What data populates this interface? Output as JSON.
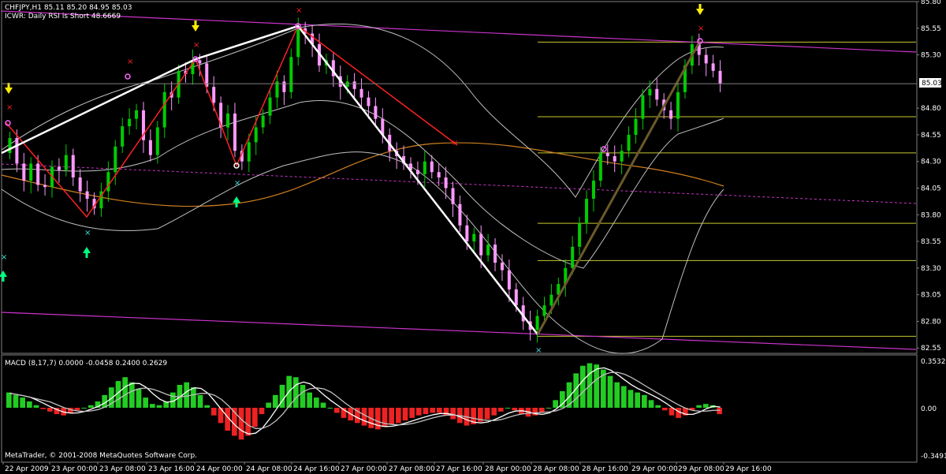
{
  "header": {
    "symbol_line": "CHFJPY,H1  85.11 85.20 84.95 85.03",
    "indicator_line": "ICWR: Daily RSI is Short 48.6669"
  },
  "macd_panel": {
    "label": "MACD  (8,17,7) 0.0000 -0.0458 0.2400 0.2629",
    "scale_labels": [
      "0.3532",
      "0.00",
      "-0.3491"
    ]
  },
  "footer": {
    "copyright": "MetaTrader, © 2001-2008 MetaQuotes Software Corp."
  },
  "colors": {
    "background": "#000000",
    "bull_candle": "#00cc00",
    "bear_candle": "#ff99ff",
    "fib_levels": "#c8c832",
    "channel": "#cc33cc",
    "bollinger": "#c0c0c0",
    "moving_average": "#d08020",
    "zigzag": "#ff2020",
    "wave_line": "#ffffff",
    "macd_pos": "#22cc22",
    "macd_neg": "#ee2222",
    "arrow_up": "#00ff80",
    "arrow_down": "#ffee00"
  },
  "chart_data": {
    "type": "candlestick",
    "symbol": "CHFJPY",
    "timeframe": "H1",
    "current_price": "85.03",
    "price_axis_labels": [
      "85.80",
      "85.55",
      "85.30",
      "85.03",
      "84.80",
      "84.55",
      "84.30",
      "84.05",
      "83.80",
      "83.55",
      "83.30",
      "83.05",
      "82.80",
      "82.55"
    ],
    "time_axis_labels": [
      "22 Apr 2009",
      "23 Apr 00:00",
      "23 Apr 08:00",
      "23 Apr 16:00",
      "24 Apr 00:00",
      "24 Apr 08:00",
      "24 Apr 16:00",
      "27 Apr 00:00",
      "27 Apr 08:00",
      "27 Apr 16:00",
      "28 Apr 00:00",
      "28 Apr 08:00",
      "28 Apr 16:00",
      "29 Apr 00:00",
      "29 Apr 08:00",
      "29 Apr 16:00"
    ],
    "ylim": [
      82.5,
      85.8
    ],
    "fib_levels": [
      85.42,
      84.72,
      84.38,
      83.72,
      83.37,
      82.66
    ],
    "price_path": [
      84.38,
      84.52,
      84.28,
      84.12,
      84.28,
      84.08,
      84.06,
      84.25,
      84.22,
      84.36,
      84.15,
      84.02,
      83.95,
      83.86,
      84.02,
      84.2,
      84.44,
      84.63,
      84.7,
      84.78,
      84.5,
      84.36,
      84.62,
      84.95,
      84.9,
      85.15,
      85.12,
      85.25,
      85.22,
      85.0,
      84.85,
      84.62,
      84.75,
      84.4,
      84.3,
      84.48,
      84.62,
      84.73,
      84.9,
      85.05,
      84.95,
      85.28,
      85.55,
      85.5,
      85.4,
      85.2,
      85.25,
      85.1,
      85.0,
      85.05,
      84.98,
      84.9,
      84.82,
      84.7,
      84.55,
      84.4,
      84.35,
      84.28,
      84.22,
      84.18,
      84.3,
      84.2,
      84.15,
      84.05,
      83.9,
      83.7,
      83.55,
      83.62,
      83.42,
      83.52,
      83.35,
      83.28,
      83.1,
      82.95,
      82.8,
      82.72,
      82.85,
      82.95,
      83.05,
      83.15,
      83.3,
      83.5,
      83.72,
      83.95,
      84.12,
      84.38,
      84.35,
      84.3,
      84.4,
      84.55,
      84.7,
      84.92,
      84.98,
      84.88,
      84.78,
      84.7,
      84.95,
      85.2,
      85.4,
      85.3,
      85.22,
      85.15,
      85.03
    ],
    "macd_hist": [
      0.12,
      0.1,
      0.08,
      0.05,
      0.02,
      -0.01,
      -0.03,
      -0.05,
      -0.06,
      -0.04,
      -0.02,
      0.0,
      0.02,
      0.05,
      0.1,
      0.16,
      0.21,
      0.24,
      0.2,
      0.15,
      0.08,
      0.03,
      0.02,
      0.05,
      0.12,
      0.18,
      0.2,
      0.16,
      0.1,
      0.02,
      -0.06,
      -0.12,
      -0.18,
      -0.22,
      -0.25,
      -0.22,
      -0.15,
      -0.05,
      0.04,
      0.1,
      0.18,
      0.25,
      0.24,
      0.18,
      0.12,
      0.08,
      0.04,
      0.0,
      -0.04,
      -0.08,
      -0.1,
      -0.12,
      -0.14,
      -0.16,
      -0.17,
      -0.15,
      -0.13,
      -0.12,
      -0.1,
      -0.08,
      -0.06,
      -0.05,
      -0.04,
      -0.04,
      -0.06,
      -0.09,
      -0.12,
      -0.14,
      -0.13,
      -0.11,
      -0.09,
      -0.06,
      -0.03,
      0.0,
      -0.02,
      -0.05,
      -0.07,
      -0.06,
      -0.04,
      0.0,
      0.06,
      0.13,
      0.2,
      0.27,
      0.33,
      0.35,
      0.34,
      0.3,
      0.25,
      0.2,
      0.17,
      0.14,
      0.12,
      0.1,
      0.06,
      0.02,
      -0.02,
      -0.06,
      -0.08,
      -0.06,
      -0.02,
      0.02,
      0.03,
      0.02,
      -0.05
    ]
  }
}
